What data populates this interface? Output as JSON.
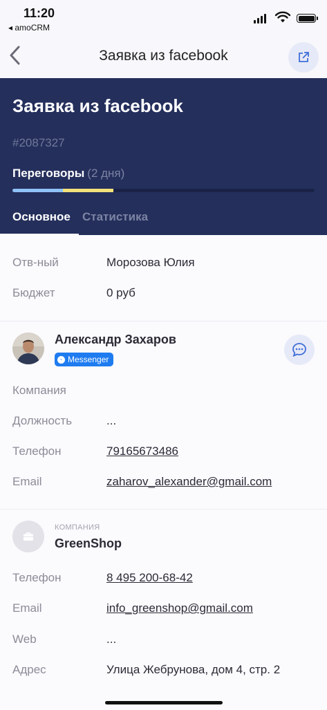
{
  "status_bar": {
    "time": "11:20",
    "back_app": "◂ amoCRM"
  },
  "navbar": {
    "title": "Заявка из facebook"
  },
  "deal": {
    "name": "Заявка из facebook",
    "id": "#2087327",
    "stage": "Переговоры",
    "stage_duration": "(2 дня)",
    "pipeline_colors": [
      "#8fc2f7",
      "#f3e27b"
    ]
  },
  "tabs": [
    {
      "label": "Основное",
      "active": true
    },
    {
      "label": "Статистика",
      "active": false
    }
  ],
  "main_fields": [
    {
      "label": "Отв-ный",
      "value": "Морозова Юлия"
    },
    {
      "label": "Бюджет",
      "value": "0 руб"
    }
  ],
  "contact": {
    "name": "Александр Захаров",
    "source_badge": "Messenger",
    "fields": [
      {
        "label": "Компания",
        "value": ""
      },
      {
        "label": "Должность",
        "value": "..."
      },
      {
        "label": "Телефон",
        "value": "79165673486"
      },
      {
        "label": "Email",
        "value": "zaharov_alexander@gmail.com"
      }
    ]
  },
  "company": {
    "kicker": "КОМПАНИЯ",
    "name": "GreenShop",
    "fields": [
      {
        "label": "Телефон",
        "value": "8 495 200-68-42"
      },
      {
        "label": "Email",
        "value": "info_greenshop@gmail.com"
      },
      {
        "label": "Web",
        "value": "..."
      },
      {
        "label": "Адрес",
        "value": "Улица Жебрунова, дом 4, стр. 2"
      }
    ]
  },
  "colors": {
    "header_bg": "#242f5c",
    "accent_badge": "#1f7cf0"
  },
  "icons": [
    "back-chevron-icon",
    "external-link-icon",
    "chat-icon",
    "messenger-icon",
    "briefcase-icon",
    "signal-icon",
    "wifi-icon",
    "battery-icon"
  ]
}
